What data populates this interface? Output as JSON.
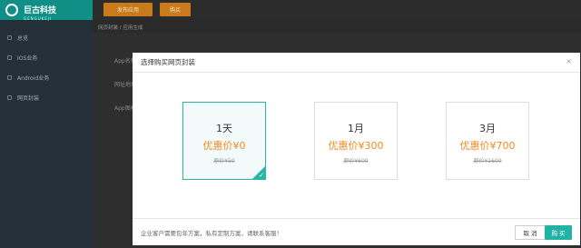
{
  "app": {
    "brand": "巨古科技",
    "brand_sub": "GENGUKEJI",
    "sidebar": [
      {
        "label": "总览"
      },
      {
        "label": "IOS业务"
      },
      {
        "label": "Android业务"
      },
      {
        "label": "网页封装"
      }
    ],
    "topbar": {
      "publish_label": "发布应用",
      "buy_label": "购买"
    },
    "breadcrumb": "网页封装  /  应用生成",
    "content_rows": [
      "App名称",
      "网址地址",
      "App图标"
    ]
  },
  "modal": {
    "title": "选择购买网页封装",
    "close": "×",
    "plans": [
      {
        "period": "1天",
        "price": "优惠价¥0",
        "original": "原价¥50",
        "selected": true
      },
      {
        "period": "1月",
        "price": "优惠价¥300",
        "original": "原价¥600",
        "selected": false
      },
      {
        "period": "3月",
        "price": "优惠价¥700",
        "original": "原价¥1600",
        "selected": false
      }
    ],
    "footer_note": "企业客户需要包年方案，私有定制方案，请联系客服！",
    "cancel_label": "取 消",
    "buy_label": "购 买"
  }
}
